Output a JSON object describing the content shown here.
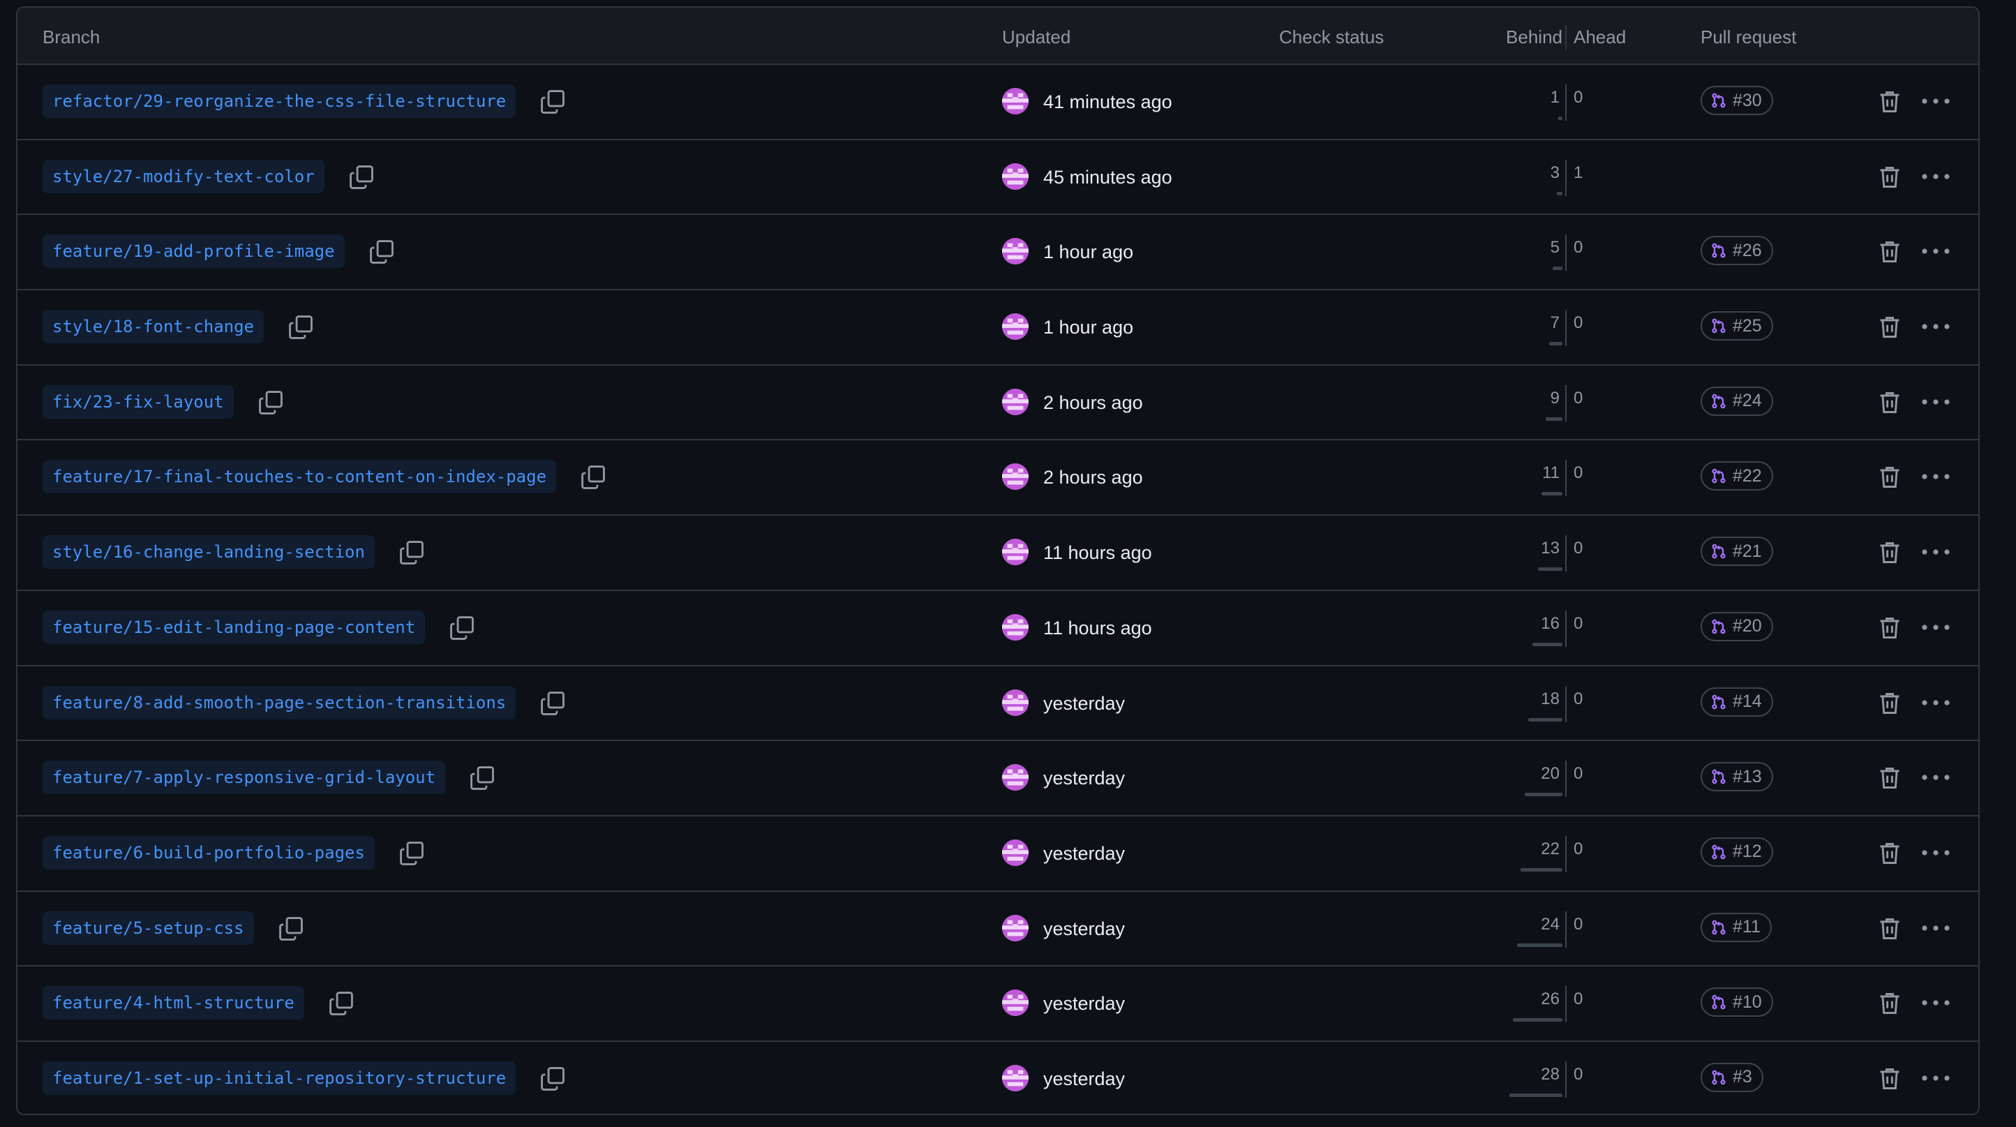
{
  "columns": {
    "branch": "Branch",
    "updated": "Updated",
    "check_status": "Check status",
    "behind": "Behind",
    "ahead": "Ahead",
    "pull_request": "Pull request"
  },
  "colors": {
    "branch_text": "#4493f8",
    "branch_bg": "#121d2f",
    "avatar": "#c05ad8",
    "pr_icon": "#a371f7",
    "muted": "#9198a1",
    "border": "#30363d"
  },
  "icons": {
    "copy": "copy-icon",
    "avatar": "identicon-avatar",
    "pr": "git-pull-request-icon",
    "delete": "trash-icon",
    "more": "kebab-horizontal-icon"
  },
  "max_behind": 28,
  "branches": [
    {
      "name": "refactor/29-reorganize-the-css-file-structure",
      "updated": "41 minutes ago",
      "behind": "1",
      "ahead": "0",
      "pr": "#30"
    },
    {
      "name": "style/27-modify-text-color",
      "updated": "45 minutes ago",
      "behind": "3",
      "ahead": "1",
      "pr": ""
    },
    {
      "name": "feature/19-add-profile-image",
      "updated": "1 hour ago",
      "behind": "5",
      "ahead": "0",
      "pr": "#26"
    },
    {
      "name": "style/18-font-change",
      "updated": "1 hour ago",
      "behind": "7",
      "ahead": "0",
      "pr": "#25"
    },
    {
      "name": "fix/23-fix-layout",
      "updated": "2 hours ago",
      "behind": "9",
      "ahead": "0",
      "pr": "#24"
    },
    {
      "name": "feature/17-final-touches-to-content-on-index-page",
      "updated": "2 hours ago",
      "behind": "11",
      "ahead": "0",
      "pr": "#22"
    },
    {
      "name": "style/16-change-landing-section",
      "updated": "11 hours ago",
      "behind": "13",
      "ahead": "0",
      "pr": "#21"
    },
    {
      "name": "feature/15-edit-landing-page-content",
      "updated": "11 hours ago",
      "behind": "16",
      "ahead": "0",
      "pr": "#20"
    },
    {
      "name": "feature/8-add-smooth-page-section-transitions",
      "updated": "yesterday",
      "behind": "18",
      "ahead": "0",
      "pr": "#14"
    },
    {
      "name": "feature/7-apply-responsive-grid-layout",
      "updated": "yesterday",
      "behind": "20",
      "ahead": "0",
      "pr": "#13"
    },
    {
      "name": "feature/6-build-portfolio-pages",
      "updated": "yesterday",
      "behind": "22",
      "ahead": "0",
      "pr": "#12"
    },
    {
      "name": "feature/5-setup-css",
      "updated": "yesterday",
      "behind": "24",
      "ahead": "0",
      "pr": "#11"
    },
    {
      "name": "feature/4-html-structure",
      "updated": "yesterday",
      "behind": "26",
      "ahead": "0",
      "pr": "#10"
    },
    {
      "name": "feature/1-set-up-initial-repository-structure",
      "updated": "yesterday",
      "behind": "28",
      "ahead": "0",
      "pr": "#3"
    }
  ]
}
